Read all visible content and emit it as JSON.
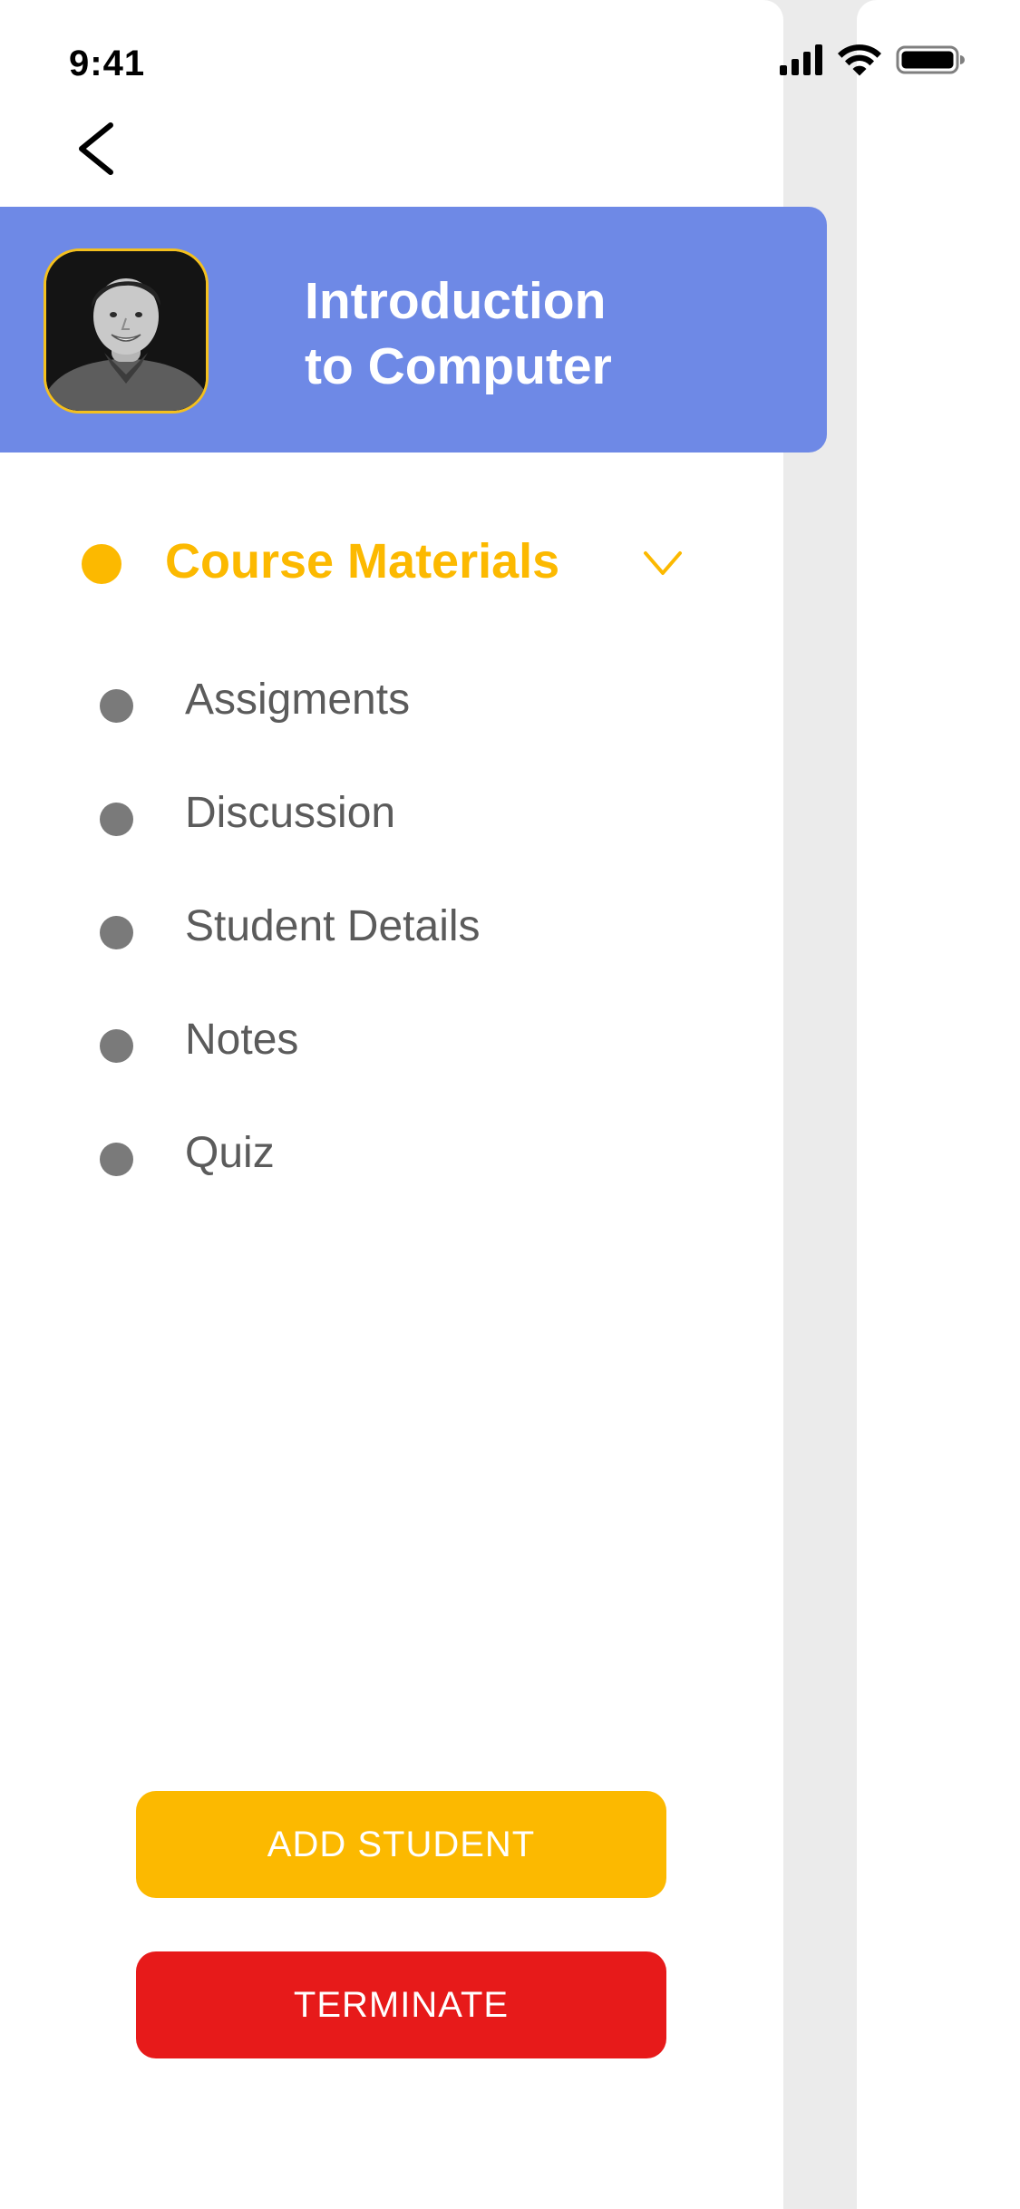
{
  "status_bar": {
    "time": "9:41",
    "icons": [
      "cellular-signal-icon",
      "wifi-icon",
      "battery-icon"
    ]
  },
  "header": {
    "back_icon": "chevron-left-icon",
    "title_line1": "Introduction",
    "title_line2": "to Computer",
    "avatar": "instructor-photo"
  },
  "section": {
    "label": "Course Materials",
    "expanded": true,
    "chevron_icon": "chevron-down-icon"
  },
  "menu": {
    "items": [
      {
        "label": "Assigments"
      },
      {
        "label": "Discussion"
      },
      {
        "label": "Student Details"
      },
      {
        "label": "Notes"
      },
      {
        "label": "Quiz"
      }
    ]
  },
  "buttons": {
    "add_student": "ADD STUDENT",
    "terminate": "TERMINATE"
  },
  "colors": {
    "accent": "#fcb900",
    "banner": "#6e89e6",
    "danger": "#e71a1a",
    "bullet": "#7a7a7a",
    "text": "#5b5b5b"
  }
}
